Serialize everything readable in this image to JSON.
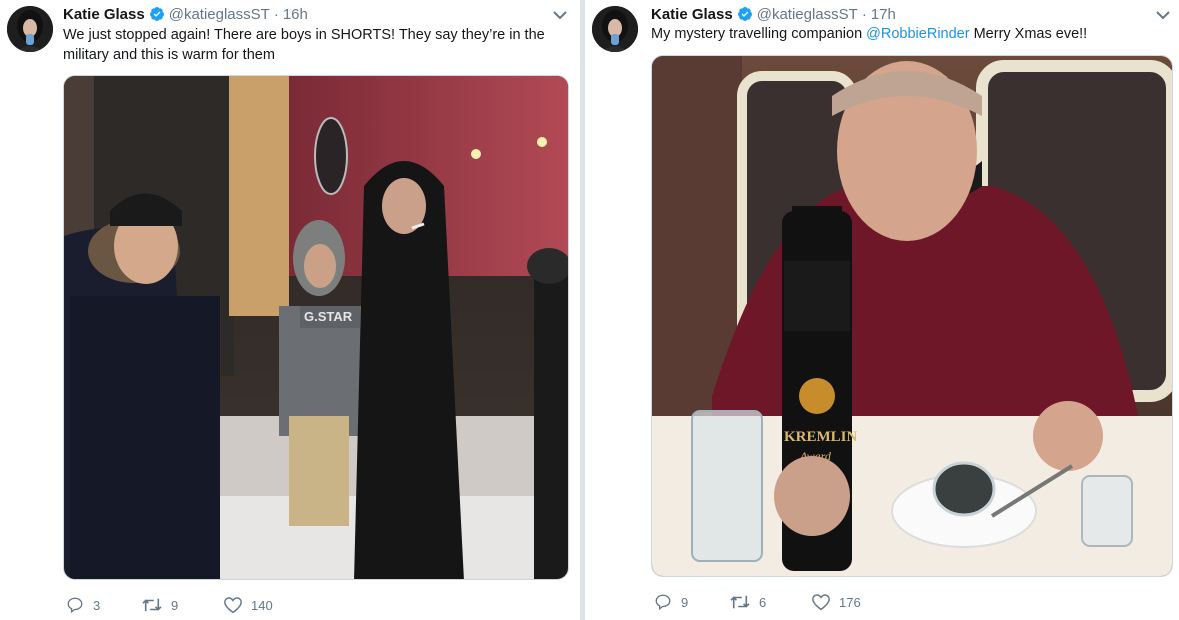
{
  "tweets": [
    {
      "author_name": "Katie Glass",
      "handle": "@katieglassST",
      "separator": "·",
      "time": "16h",
      "text": "We just stopped again! There are boys in SHORTS! They say they’re in the military and this is warm for them",
      "photo_sign_text": "G.STAR",
      "replies": "3",
      "retweets": "9",
      "likes": "140"
    },
    {
      "author_name": "Katie Glass",
      "handle": "@katieglassST",
      "separator": "·",
      "time": "17h",
      "text_before": "My mystery travelling companion ",
      "mention": "@RobbieRinder",
      "text_after": " Merry Xmas eve!!",
      "photo_label_brand": "KREMLIN",
      "photo_label_sub": "Award",
      "replies": "9",
      "retweets": "6",
      "likes": "176"
    }
  ],
  "colors": {
    "verified": "#1da1f2",
    "mention": "#1b95e0",
    "muted": "#657786"
  },
  "icons": {
    "verified": "verified-badge-icon",
    "caret": "chevron-down-icon",
    "reply": "reply-icon",
    "retweet": "retweet-icon",
    "like": "heart-icon"
  }
}
